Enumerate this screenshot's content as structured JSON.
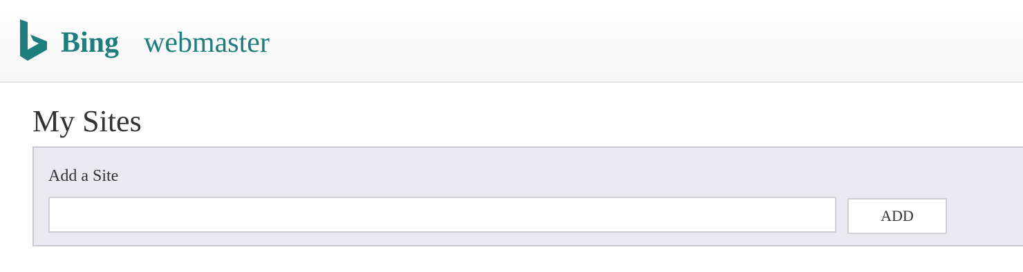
{
  "header": {
    "logo_icon": "bing-logo-icon",
    "brand": "Bing",
    "product": "webmaster",
    "brand_color": "#1c7f7d"
  },
  "main": {
    "title": "My Sites",
    "add_site": {
      "label": "Add a Site",
      "input_value": "",
      "button_label": "ADD"
    }
  }
}
